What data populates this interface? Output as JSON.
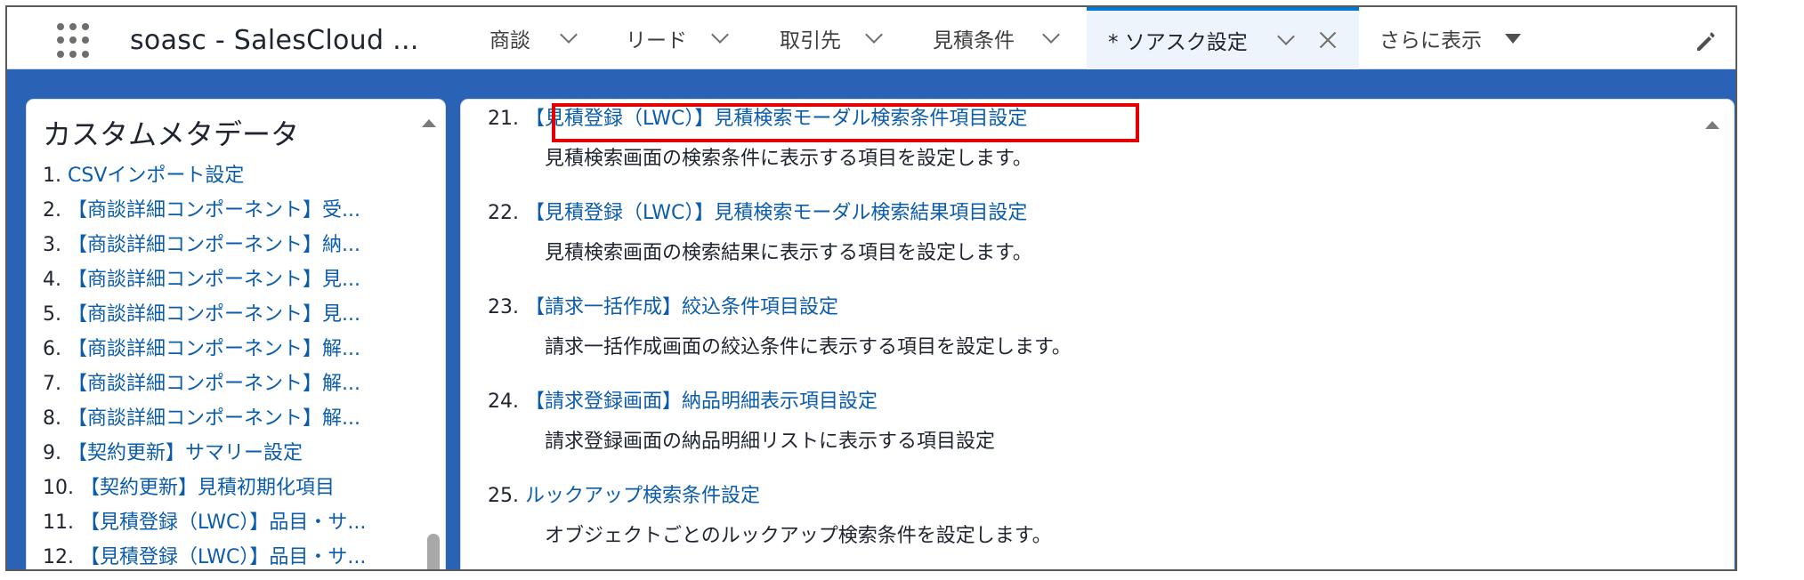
{
  "app": {
    "name": "soasc - SalesCloud ..."
  },
  "nav": {
    "tabs": [
      {
        "label": "商談"
      },
      {
        "label": "リード"
      },
      {
        "label": "取引先"
      },
      {
        "label": "見積条件"
      }
    ],
    "active_tab": {
      "label": "* ソアスク設定"
    },
    "more_label": "さらに表示"
  },
  "sidebar": {
    "title": "カスタムメタデータ",
    "items": [
      {
        "num": "1.",
        "label": "CSVインポート設定"
      },
      {
        "num": "2.",
        "label": "【商談詳細コンポーネント】受..."
      },
      {
        "num": "3.",
        "label": "【商談詳細コンポーネント】納..."
      },
      {
        "num": "4.",
        "label": "【商談詳細コンポーネント】見..."
      },
      {
        "num": "5.",
        "label": "【商談詳細コンポーネント】見..."
      },
      {
        "num": "6.",
        "label": "【商談詳細コンポーネント】解..."
      },
      {
        "num": "7.",
        "label": "【商談詳細コンポーネント】解..."
      },
      {
        "num": "8.",
        "label": "【商談詳細コンポーネント】解..."
      },
      {
        "num": "9.",
        "label": "【契約更新】サマリー設定"
      },
      {
        "num": "10.",
        "label": "【契約更新】見積初期化項目"
      },
      {
        "num": "11.",
        "label": "【見積登録（LWC）】品目・サ..."
      },
      {
        "num": "12.",
        "label": "【見積登録（LWC）】品目・サ..."
      }
    ]
  },
  "main": {
    "entries": [
      {
        "num": "21.",
        "title": "【見積登録（LWC）】見積検索モーダル検索条件項目設定",
        "desc": "見積検索画面の検索条件に表示する項目を設定します。"
      },
      {
        "num": "22.",
        "title": "【見積登録（LWC）】見積検索モーダル検索結果項目設定",
        "desc": "見積検索画面の検索結果に表示する項目を設定します。"
      },
      {
        "num": "23.",
        "title": "【請求一括作成】絞込条件項目設定",
        "desc": "請求一括作成画面の絞込条件に表示する項目を設定します。"
      },
      {
        "num": "24.",
        "title": "【請求登録画面】納品明細表示項目設定",
        "desc": "請求登録画面の納品明細リストに表示する項目設定"
      },
      {
        "num": "25.",
        "title": "ルックアップ検索条件設定",
        "desc": "オブジェクトごとのルックアップ検索条件を設定します。"
      }
    ]
  },
  "colors": {
    "link": "#0b5cab",
    "highlight": "#e40000",
    "header_bg": "#2a63b5",
    "active_tab_bg": "#eef4fb"
  }
}
